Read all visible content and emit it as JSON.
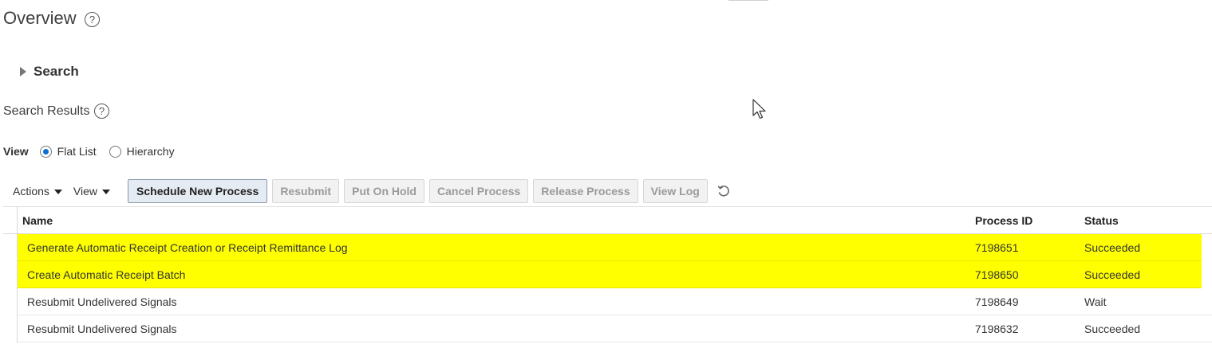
{
  "page": {
    "title": "Overview",
    "help_glyph": "?"
  },
  "search": {
    "label": "Search"
  },
  "results": {
    "title": "Search Results",
    "help_glyph": "?"
  },
  "view": {
    "label": "View",
    "options": [
      "Flat List",
      "Hierarchy"
    ],
    "selected": "Flat List"
  },
  "toolbar": {
    "actions_label": "Actions",
    "view_label": "View",
    "schedule_label": "Schedule New Process",
    "resubmit_label": "Resubmit",
    "hold_label": "Put On Hold",
    "cancel_label": "Cancel Process",
    "release_label": "Release Process",
    "viewlog_label": "View Log",
    "refresh_icon": "refresh-icon"
  },
  "table": {
    "columns": [
      "Name",
      "Process ID",
      "Status"
    ],
    "rows": [
      {
        "name": "Generate Automatic Receipt Creation or Receipt Remittance Log",
        "id": "7198651",
        "status": "Succeeded",
        "highlighted": true
      },
      {
        "name": "Create Automatic Receipt Batch",
        "id": "7198650",
        "status": "Succeeded",
        "highlighted": true
      },
      {
        "name": "Resubmit Undelivered Signals",
        "id": "7198649",
        "status": "Wait",
        "highlighted": false
      },
      {
        "name": "Resubmit Undelivered Signals",
        "id": "7198632",
        "status": "Succeeded",
        "highlighted": false
      }
    ]
  },
  "colors": {
    "highlight": "#ffff00",
    "radio_selected": "#0a6ed1"
  }
}
